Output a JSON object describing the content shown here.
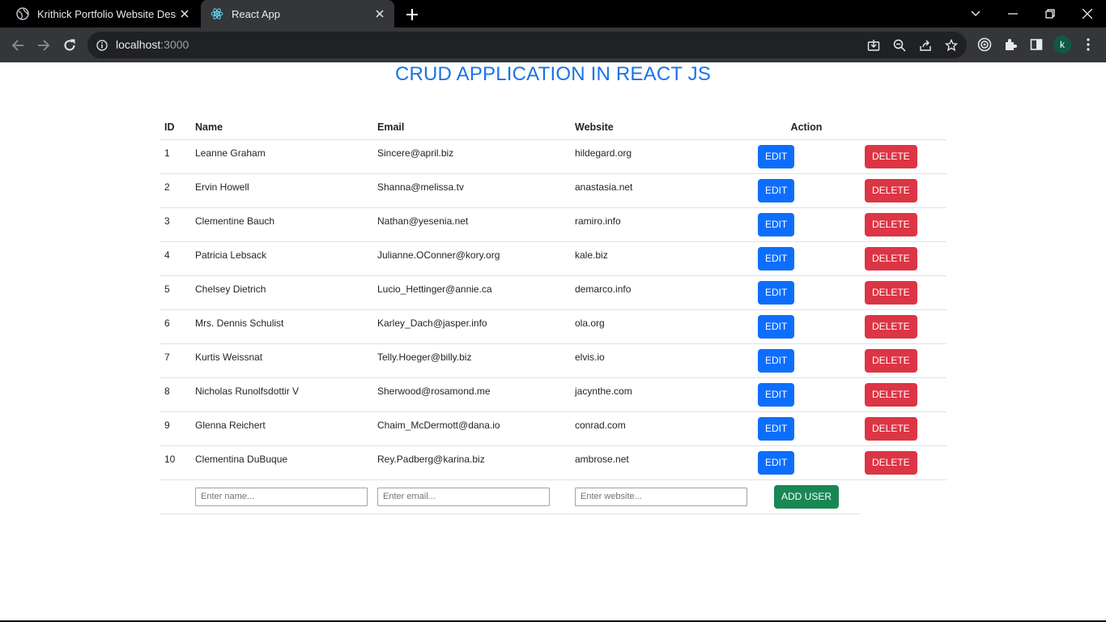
{
  "browser": {
    "tabs": [
      {
        "title": "Krithick Portfolio Website Design",
        "active": false,
        "favicon": "globe-icon"
      },
      {
        "title": "React App",
        "active": true,
        "favicon": "react-icon"
      }
    ],
    "url_host": "localhost",
    "url_port": ":3000",
    "profile_initial": "k"
  },
  "page": {
    "title": "CRUD APPLICATION IN REACT JS",
    "title_color": "#1a73e8"
  },
  "table": {
    "headers": {
      "id": "ID",
      "name": "Name",
      "email": "Email",
      "website": "Website",
      "action": "Action"
    },
    "rows": [
      {
        "id": "1",
        "name": "Leanne Graham",
        "email": "Sincere@april.biz",
        "website": "hildegard.org"
      },
      {
        "id": "2",
        "name": "Ervin Howell",
        "email": "Shanna@melissa.tv",
        "website": "anastasia.net"
      },
      {
        "id": "3",
        "name": "Clementine Bauch",
        "email": "Nathan@yesenia.net",
        "website": "ramiro.info"
      },
      {
        "id": "4",
        "name": "Patricia Lebsack",
        "email": "Julianne.OConner@kory.org",
        "website": "kale.biz"
      },
      {
        "id": "5",
        "name": "Chelsey Dietrich",
        "email": "Lucio_Hettinger@annie.ca",
        "website": "demarco.info"
      },
      {
        "id": "6",
        "name": "Mrs. Dennis Schulist",
        "email": "Karley_Dach@jasper.info",
        "website": "ola.org"
      },
      {
        "id": "7",
        "name": "Kurtis Weissnat",
        "email": "Telly.Hoeger@billy.biz",
        "website": "elvis.io"
      },
      {
        "id": "8",
        "name": "Nicholas Runolfsdottir V",
        "email": "Sherwood@rosamond.me",
        "website": "jacynthe.com"
      },
      {
        "id": "9",
        "name": "Glenna Reichert",
        "email": "Chaim_McDermott@dana.io",
        "website": "conrad.com"
      },
      {
        "id": "10",
        "name": "Clementina DuBuque",
        "email": "Rey.Padberg@karina.biz",
        "website": "ambrose.net"
      }
    ],
    "edit_label": "EDIT",
    "delete_label": "DELETE"
  },
  "add_form": {
    "name_placeholder": "Enter name...",
    "email_placeholder": "Enter email...",
    "website_placeholder": "Enter website...",
    "add_label": "ADD USER"
  },
  "colors": {
    "edit": "#0d6efd",
    "delete": "#dc3545",
    "add": "#198754"
  }
}
